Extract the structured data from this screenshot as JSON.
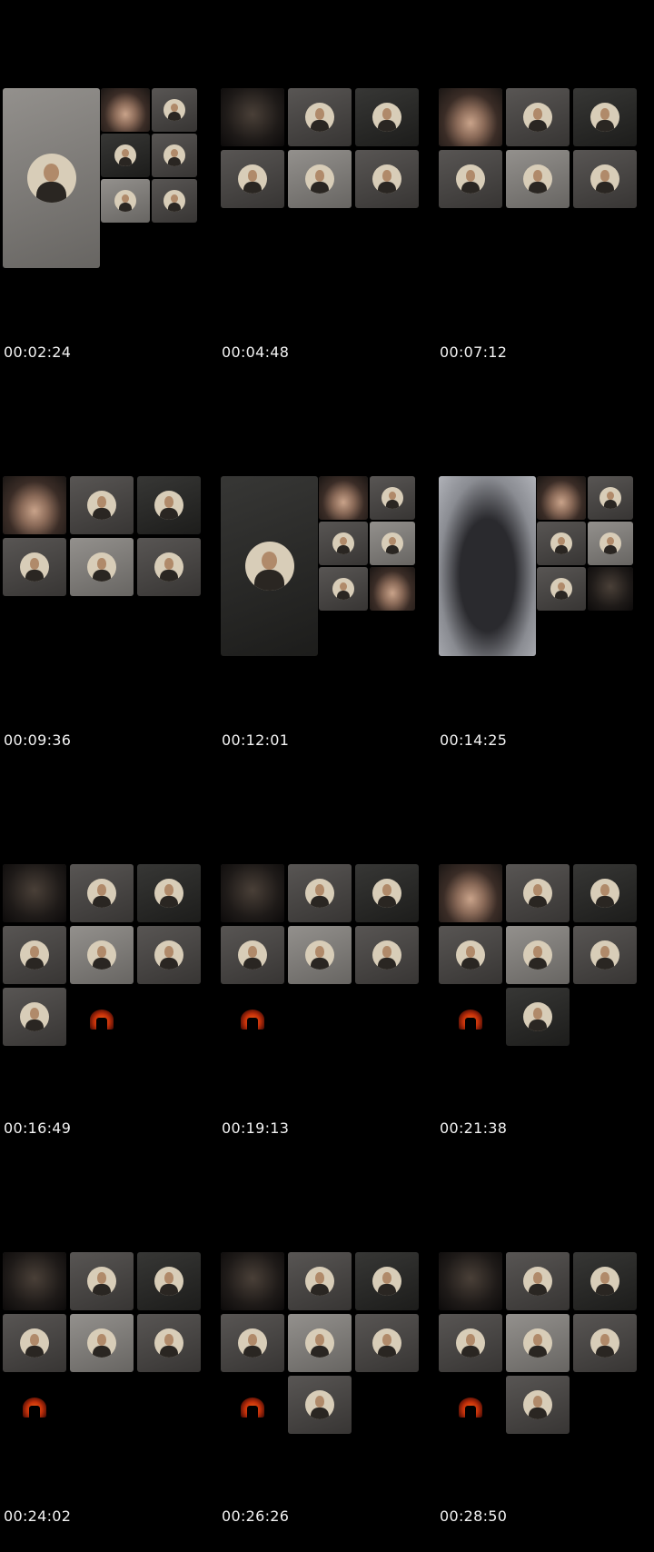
{
  "frames": [
    {
      "timestamp": "00:02:24"
    },
    {
      "timestamp": "00:04:48"
    },
    {
      "timestamp": "00:07:12"
    },
    {
      "timestamp": "00:09:36"
    },
    {
      "timestamp": "00:12:01"
    },
    {
      "timestamp": "00:14:25"
    },
    {
      "timestamp": "00:16:49"
    },
    {
      "timestamp": "00:19:13"
    },
    {
      "timestamp": "00:21:38"
    },
    {
      "timestamp": "00:24:02"
    },
    {
      "timestamp": "00:26:26"
    },
    {
      "timestamp": "00:28:50"
    }
  ],
  "colors": {
    "background": "#000000",
    "tile_dark": "#262624",
    "tile_mid": "#4a4745",
    "tile_light": "#8a8783",
    "avatar_bg": "#d8cdb8",
    "fire": "#ff6a1a",
    "text": "#f2f2f2"
  }
}
